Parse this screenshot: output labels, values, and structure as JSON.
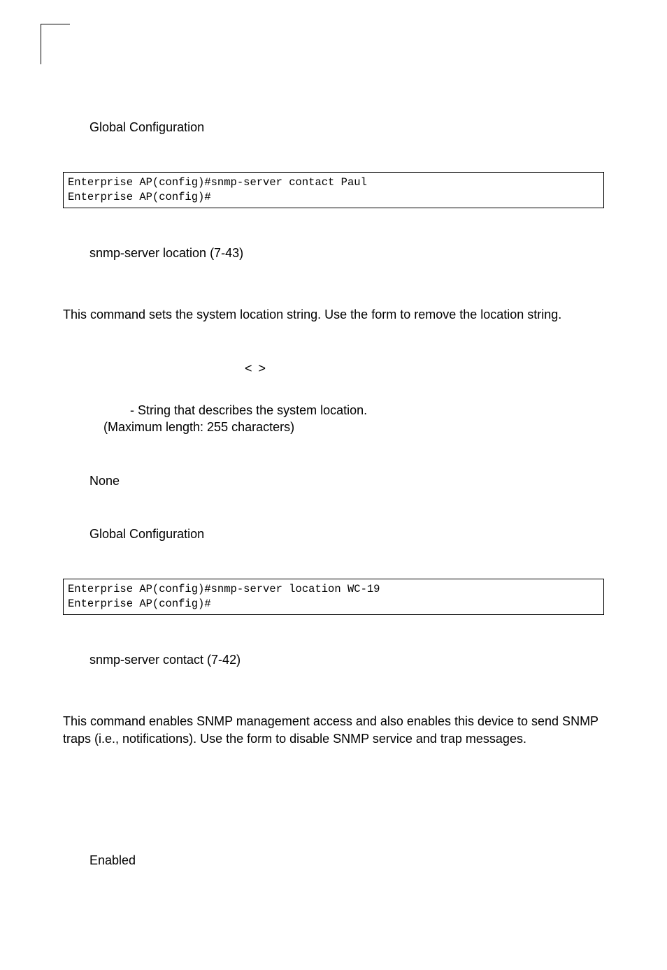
{
  "block1": {
    "commandMode": "Global Configuration",
    "code": "Enterprise AP(config)#snmp-server contact Paul\nEnterprise AP(config)#",
    "related": "snmp-server location (7-43)"
  },
  "block2": {
    "desc_pre": "This command sets the system location string. Use the ",
    "desc_post": " form to remove the location string.",
    "syntax_symbols": "<   >",
    "param_line1": " - String that describes the system location.",
    "param_line2": "(Maximum length: 255 characters)",
    "default": "None",
    "commandMode": "Global Configuration",
    "code": "Enterprise AP(config)#snmp-server location WC-19\nEnterprise AP(config)#",
    "related": "snmp-server contact (7-42)"
  },
  "block3": {
    "desc_pre": "This command enables SNMP management access and also enables this device to send SNMP traps (i.e., notifications). Use the ",
    "desc_post": " form to disable SNMP service and trap messages.",
    "default": "Enabled"
  }
}
